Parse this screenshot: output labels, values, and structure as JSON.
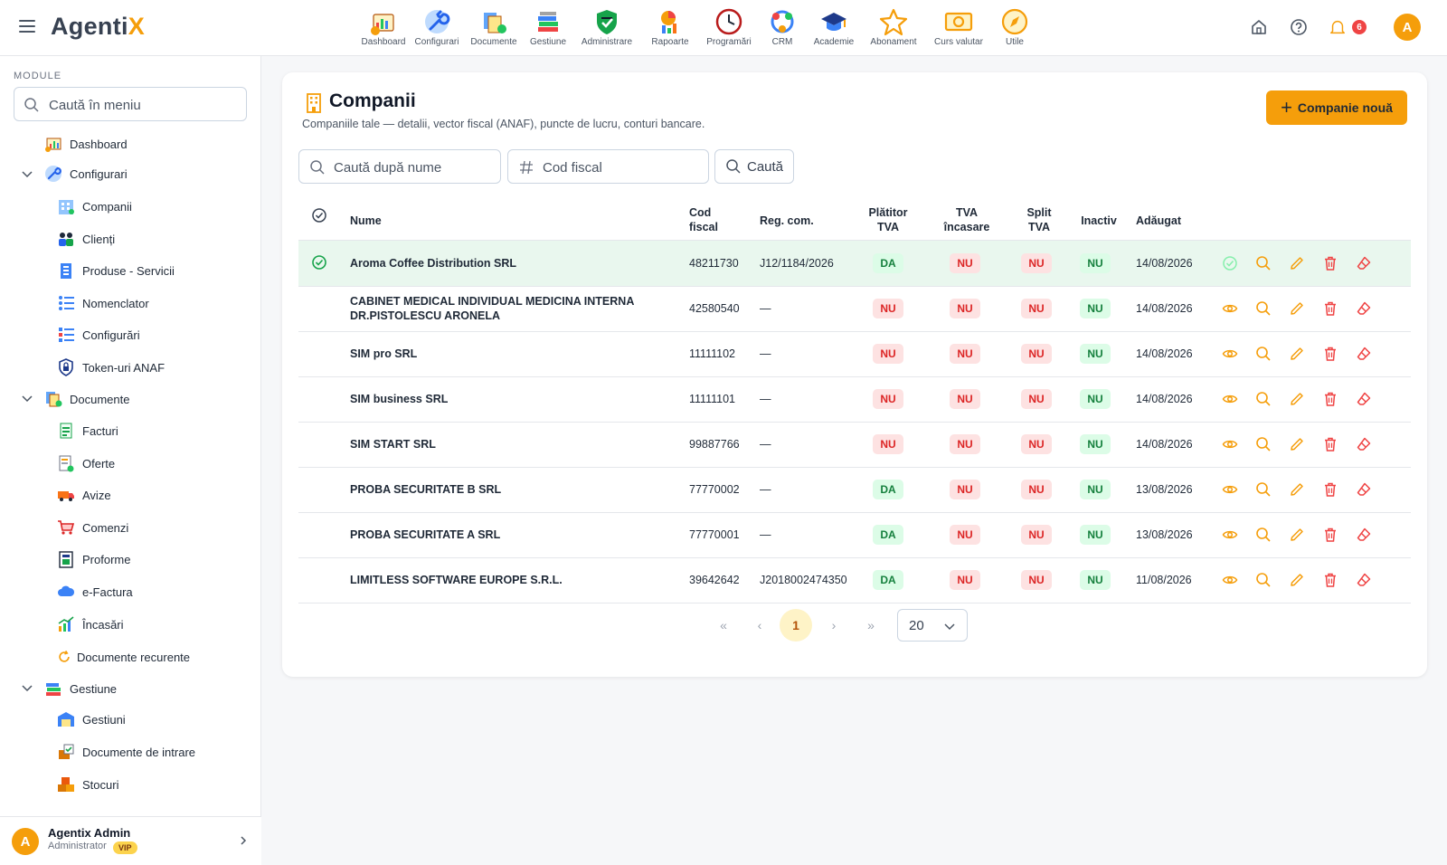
{
  "app": {
    "logo_main": "Agenti",
    "logo_accent": "X"
  },
  "topnav": [
    {
      "label": "Dashboard",
      "icon": "dashboard-icon"
    },
    {
      "label": "Configurari",
      "icon": "wrench-icon"
    },
    {
      "label": "Documente",
      "icon": "documents-icon"
    },
    {
      "label": "Gestiune",
      "icon": "books-icon"
    },
    {
      "label": "Administrare",
      "icon": "shield-icon"
    },
    {
      "label": "Rapoarte",
      "icon": "reports-icon"
    },
    {
      "label": "Programări",
      "icon": "clock-icon"
    },
    {
      "label": "CRM",
      "icon": "crm-icon"
    },
    {
      "label": "Academie",
      "icon": "graduation-cap-icon"
    },
    {
      "label": "Abonament",
      "icon": "star-icon"
    },
    {
      "label": "Curs valutar",
      "icon": "banknote-icon"
    },
    {
      "label": "Utile",
      "icon": "compass-icon"
    }
  ],
  "header": {
    "notif_count": "6",
    "avatar_letter": "A"
  },
  "sidebar": {
    "section_title": "MODULE",
    "search_placeholder": "Caută în meniu",
    "items": [
      {
        "label": "Dashboard"
      },
      {
        "label": "Configurari"
      },
      {
        "label": "Companii"
      },
      {
        "label": "Clienți"
      },
      {
        "label": "Produse - Servicii"
      },
      {
        "label": "Nomenclator"
      },
      {
        "label": "Configurări"
      },
      {
        "label": "Token-uri ANAF"
      },
      {
        "label": "Documente"
      },
      {
        "label": "Facturi"
      },
      {
        "label": "Oferte"
      },
      {
        "label": "Avize"
      },
      {
        "label": "Comenzi"
      },
      {
        "label": "Proforme"
      },
      {
        "label": "e-Factura"
      },
      {
        "label": "Încasări"
      },
      {
        "label": "Documente recurente"
      },
      {
        "label": "Gestiune"
      },
      {
        "label": "Gestiuni"
      },
      {
        "label": "Documente de intrare"
      },
      {
        "label": "Stocuri"
      }
    ],
    "user": {
      "avatar": "A",
      "name": "Agentix Admin",
      "role": "Administrator",
      "badge": "VIP"
    }
  },
  "page": {
    "title": "Companii",
    "subtitle": "Companiile tale — detalii, vector fiscal (ANAF), puncte de lucru, conturi bancare.",
    "new_button": "Companie nouă",
    "search_name_placeholder": "Caută după nume",
    "search_cif_placeholder": "Cod fiscal",
    "search_button": "Caută"
  },
  "table": {
    "headers": {
      "name": "Nume",
      "cif_1": "Cod",
      "cif_2": "fiscal",
      "reg": "Reg. com.",
      "platitor_1": "Plătitor",
      "platitor_2": "TVA",
      "tvaincasare_1": "TVA",
      "tvaincasare_2": "încasare",
      "split_1": "Split",
      "split_2": "TVA",
      "inactiv": "Inactiv",
      "added": "Adăugat"
    },
    "rows": [
      {
        "name": "Aroma Coffee Distribution SRL",
        "cif": "48211730",
        "reg": "J12/1184/2026",
        "platitor": "DA",
        "tva_incasare": "NU",
        "split": "NU",
        "inactiv": "NU",
        "added": "14/08/2026",
        "selected": true
      },
      {
        "name": "CABINET MEDICAL INDIVIDUAL MEDICINA INTERNA DR.PISTOLESCU ARONELA",
        "cif": "42580540",
        "reg": "—",
        "platitor": "NU",
        "tva_incasare": "NU",
        "split": "NU",
        "inactiv": "NU",
        "added": "14/08/2026",
        "selected": false
      },
      {
        "name": "SIM pro SRL",
        "cif": "11111102",
        "reg": "—",
        "platitor": "NU",
        "tva_incasare": "NU",
        "split": "NU",
        "inactiv": "NU",
        "added": "14/08/2026",
        "selected": false
      },
      {
        "name": "SIM business SRL",
        "cif": "11111101",
        "reg": "—",
        "platitor": "NU",
        "tva_incasare": "NU",
        "split": "NU",
        "inactiv": "NU",
        "added": "14/08/2026",
        "selected": false
      },
      {
        "name": "SIM START SRL",
        "cif": "99887766",
        "reg": "—",
        "platitor": "NU",
        "tva_incasare": "NU",
        "split": "NU",
        "inactiv": "NU",
        "added": "14/08/2026",
        "selected": false
      },
      {
        "name": "PROBA SECURITATE B SRL",
        "cif": "77770002",
        "reg": "—",
        "platitor": "DA",
        "tva_incasare": "NU",
        "split": "NU",
        "inactiv": "NU",
        "added": "13/08/2026",
        "selected": false
      },
      {
        "name": "PROBA SECURITATE A SRL",
        "cif": "77770001",
        "reg": "—",
        "platitor": "DA",
        "tva_incasare": "NU",
        "split": "NU",
        "inactiv": "NU",
        "added": "13/08/2026",
        "selected": false
      },
      {
        "name": "LIMITLESS SOFTWARE EUROPE S.R.L.",
        "cif": "39642642",
        "reg": "J2018002474350",
        "platitor": "DA",
        "tva_incasare": "NU",
        "split": "NU",
        "inactiv": "NU",
        "added": "11/08/2026",
        "selected": false
      }
    ]
  },
  "pagination": {
    "current_page": "1",
    "page_size": "20"
  },
  "colors": {
    "accent": "#f59e0b",
    "selected_row": "#e9f7ee",
    "da_green": "#15803d",
    "nu_red": "#dc2626"
  }
}
